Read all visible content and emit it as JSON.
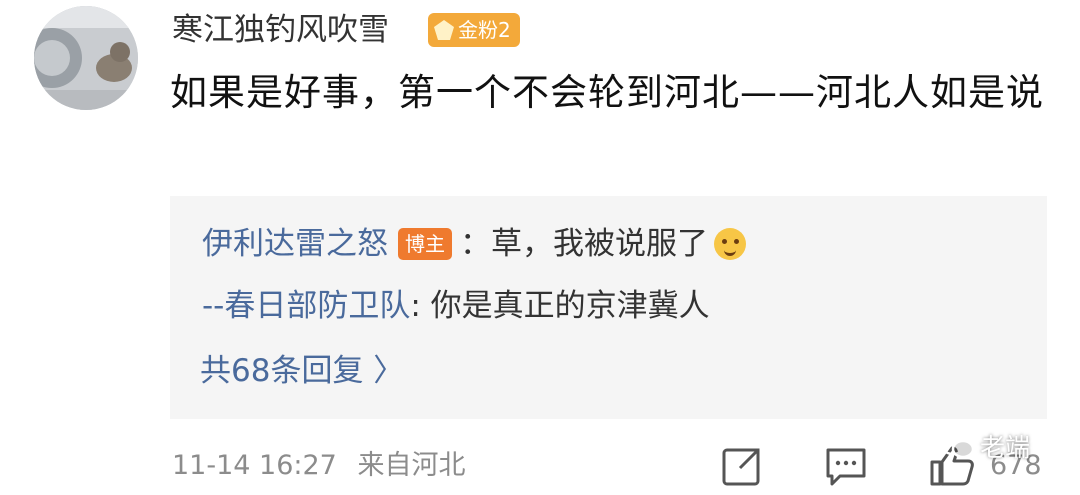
{
  "comment": {
    "username": "寒江独钓风吹雪",
    "fan_badge": "金粉2",
    "text": "如果是好事，第一个不会轮到河北——河北人如是说"
  },
  "replies": [
    {
      "name": "伊利达雷之怒",
      "badge": "博主",
      "text": "：草，我被说服了"
    },
    {
      "name": "--春日部防卫队",
      "text": ": 你是真正的京津冀人"
    }
  ],
  "more_replies_label": "共68条回复 〉",
  "footer": {
    "timestamp": "11-14 16:27",
    "location": "来自河北",
    "like_count": "678"
  },
  "watermark": "老端",
  "icons": [
    "avatar-image",
    "gold-fan-icon",
    "laugh-emoji-icon",
    "share-icon",
    "comment-icon",
    "like-icon",
    "wechat-icon"
  ],
  "colors": {
    "link_blue": "#4a6a9c",
    "badge_gold": "#f3a93a",
    "host_badge_orange": "#ef7a2e",
    "meta_gray": "#8c8c8c",
    "reply_bg": "#f5f5f5"
  }
}
